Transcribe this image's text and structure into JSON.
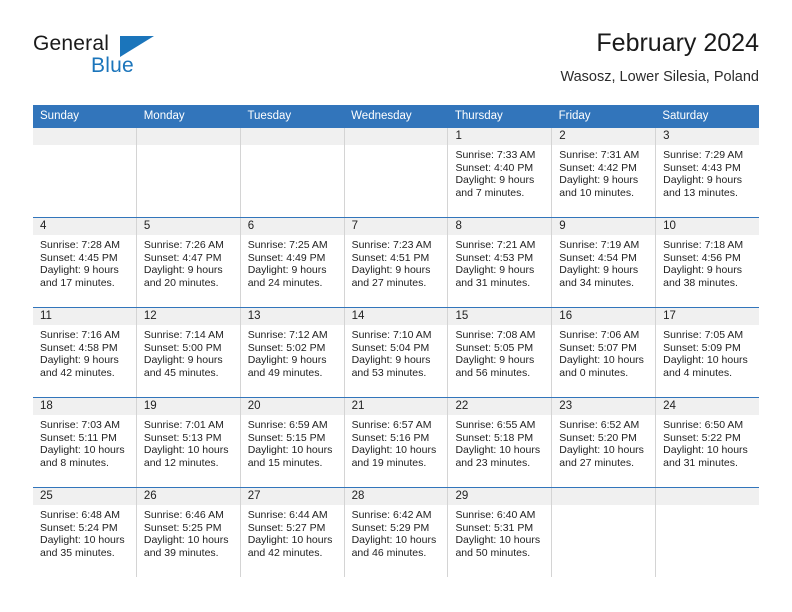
{
  "brand": {
    "name_top": "General",
    "name_bottom": "Blue",
    "accent_color": "#1b75bb"
  },
  "header": {
    "title": "February 2024",
    "subtitle": "Wasosz, Lower Silesia, Poland"
  },
  "theme": {
    "header_blue": "#3275bb",
    "daynum_band": "#f0f0f0",
    "cell_border": "#d4d4d4"
  },
  "weekdays": [
    "Sunday",
    "Monday",
    "Tuesday",
    "Wednesday",
    "Thursday",
    "Friday",
    "Saturday"
  ],
  "weeks": [
    [
      {
        "day": "",
        "sunrise": "",
        "sunset": "",
        "daylight1": "",
        "daylight2": ""
      },
      {
        "day": "",
        "sunrise": "",
        "sunset": "",
        "daylight1": "",
        "daylight2": ""
      },
      {
        "day": "",
        "sunrise": "",
        "sunset": "",
        "daylight1": "",
        "daylight2": ""
      },
      {
        "day": "",
        "sunrise": "",
        "sunset": "",
        "daylight1": "",
        "daylight2": ""
      },
      {
        "day": "1",
        "sunrise": "Sunrise: 7:33 AM",
        "sunset": "Sunset: 4:40 PM",
        "daylight1": "Daylight: 9 hours",
        "daylight2": "and 7 minutes."
      },
      {
        "day": "2",
        "sunrise": "Sunrise: 7:31 AM",
        "sunset": "Sunset: 4:42 PM",
        "daylight1": "Daylight: 9 hours",
        "daylight2": "and 10 minutes."
      },
      {
        "day": "3",
        "sunrise": "Sunrise: 7:29 AM",
        "sunset": "Sunset: 4:43 PM",
        "daylight1": "Daylight: 9 hours",
        "daylight2": "and 13 minutes."
      }
    ],
    [
      {
        "day": "4",
        "sunrise": "Sunrise: 7:28 AM",
        "sunset": "Sunset: 4:45 PM",
        "daylight1": "Daylight: 9 hours",
        "daylight2": "and 17 minutes."
      },
      {
        "day": "5",
        "sunrise": "Sunrise: 7:26 AM",
        "sunset": "Sunset: 4:47 PM",
        "daylight1": "Daylight: 9 hours",
        "daylight2": "and 20 minutes."
      },
      {
        "day": "6",
        "sunrise": "Sunrise: 7:25 AM",
        "sunset": "Sunset: 4:49 PM",
        "daylight1": "Daylight: 9 hours",
        "daylight2": "and 24 minutes."
      },
      {
        "day": "7",
        "sunrise": "Sunrise: 7:23 AM",
        "sunset": "Sunset: 4:51 PM",
        "daylight1": "Daylight: 9 hours",
        "daylight2": "and 27 minutes."
      },
      {
        "day": "8",
        "sunrise": "Sunrise: 7:21 AM",
        "sunset": "Sunset: 4:53 PM",
        "daylight1": "Daylight: 9 hours",
        "daylight2": "and 31 minutes."
      },
      {
        "day": "9",
        "sunrise": "Sunrise: 7:19 AM",
        "sunset": "Sunset: 4:54 PM",
        "daylight1": "Daylight: 9 hours",
        "daylight2": "and 34 minutes."
      },
      {
        "day": "10",
        "sunrise": "Sunrise: 7:18 AM",
        "sunset": "Sunset: 4:56 PM",
        "daylight1": "Daylight: 9 hours",
        "daylight2": "and 38 minutes."
      }
    ],
    [
      {
        "day": "11",
        "sunrise": "Sunrise: 7:16 AM",
        "sunset": "Sunset: 4:58 PM",
        "daylight1": "Daylight: 9 hours",
        "daylight2": "and 42 minutes."
      },
      {
        "day": "12",
        "sunrise": "Sunrise: 7:14 AM",
        "sunset": "Sunset: 5:00 PM",
        "daylight1": "Daylight: 9 hours",
        "daylight2": "and 45 minutes."
      },
      {
        "day": "13",
        "sunrise": "Sunrise: 7:12 AM",
        "sunset": "Sunset: 5:02 PM",
        "daylight1": "Daylight: 9 hours",
        "daylight2": "and 49 minutes."
      },
      {
        "day": "14",
        "sunrise": "Sunrise: 7:10 AM",
        "sunset": "Sunset: 5:04 PM",
        "daylight1": "Daylight: 9 hours",
        "daylight2": "and 53 minutes."
      },
      {
        "day": "15",
        "sunrise": "Sunrise: 7:08 AM",
        "sunset": "Sunset: 5:05 PM",
        "daylight1": "Daylight: 9 hours",
        "daylight2": "and 56 minutes."
      },
      {
        "day": "16",
        "sunrise": "Sunrise: 7:06 AM",
        "sunset": "Sunset: 5:07 PM",
        "daylight1": "Daylight: 10 hours",
        "daylight2": "and 0 minutes."
      },
      {
        "day": "17",
        "sunrise": "Sunrise: 7:05 AM",
        "sunset": "Sunset: 5:09 PM",
        "daylight1": "Daylight: 10 hours",
        "daylight2": "and 4 minutes."
      }
    ],
    [
      {
        "day": "18",
        "sunrise": "Sunrise: 7:03 AM",
        "sunset": "Sunset: 5:11 PM",
        "daylight1": "Daylight: 10 hours",
        "daylight2": "and 8 minutes."
      },
      {
        "day": "19",
        "sunrise": "Sunrise: 7:01 AM",
        "sunset": "Sunset: 5:13 PM",
        "daylight1": "Daylight: 10 hours",
        "daylight2": "and 12 minutes."
      },
      {
        "day": "20",
        "sunrise": "Sunrise: 6:59 AM",
        "sunset": "Sunset: 5:15 PM",
        "daylight1": "Daylight: 10 hours",
        "daylight2": "and 15 minutes."
      },
      {
        "day": "21",
        "sunrise": "Sunrise: 6:57 AM",
        "sunset": "Sunset: 5:16 PM",
        "daylight1": "Daylight: 10 hours",
        "daylight2": "and 19 minutes."
      },
      {
        "day": "22",
        "sunrise": "Sunrise: 6:55 AM",
        "sunset": "Sunset: 5:18 PM",
        "daylight1": "Daylight: 10 hours",
        "daylight2": "and 23 minutes."
      },
      {
        "day": "23",
        "sunrise": "Sunrise: 6:52 AM",
        "sunset": "Sunset: 5:20 PM",
        "daylight1": "Daylight: 10 hours",
        "daylight2": "and 27 minutes."
      },
      {
        "day": "24",
        "sunrise": "Sunrise: 6:50 AM",
        "sunset": "Sunset: 5:22 PM",
        "daylight1": "Daylight: 10 hours",
        "daylight2": "and 31 minutes."
      }
    ],
    [
      {
        "day": "25",
        "sunrise": "Sunrise: 6:48 AM",
        "sunset": "Sunset: 5:24 PM",
        "daylight1": "Daylight: 10 hours",
        "daylight2": "and 35 minutes."
      },
      {
        "day": "26",
        "sunrise": "Sunrise: 6:46 AM",
        "sunset": "Sunset: 5:25 PM",
        "daylight1": "Daylight: 10 hours",
        "daylight2": "and 39 minutes."
      },
      {
        "day": "27",
        "sunrise": "Sunrise: 6:44 AM",
        "sunset": "Sunset: 5:27 PM",
        "daylight1": "Daylight: 10 hours",
        "daylight2": "and 42 minutes."
      },
      {
        "day": "28",
        "sunrise": "Sunrise: 6:42 AM",
        "sunset": "Sunset: 5:29 PM",
        "daylight1": "Daylight: 10 hours",
        "daylight2": "and 46 minutes."
      },
      {
        "day": "29",
        "sunrise": "Sunrise: 6:40 AM",
        "sunset": "Sunset: 5:31 PM",
        "daylight1": "Daylight: 10 hours",
        "daylight2": "and 50 minutes."
      },
      {
        "day": "",
        "sunrise": "",
        "sunset": "",
        "daylight1": "",
        "daylight2": ""
      },
      {
        "day": "",
        "sunrise": "",
        "sunset": "",
        "daylight1": "",
        "daylight2": ""
      }
    ]
  ]
}
